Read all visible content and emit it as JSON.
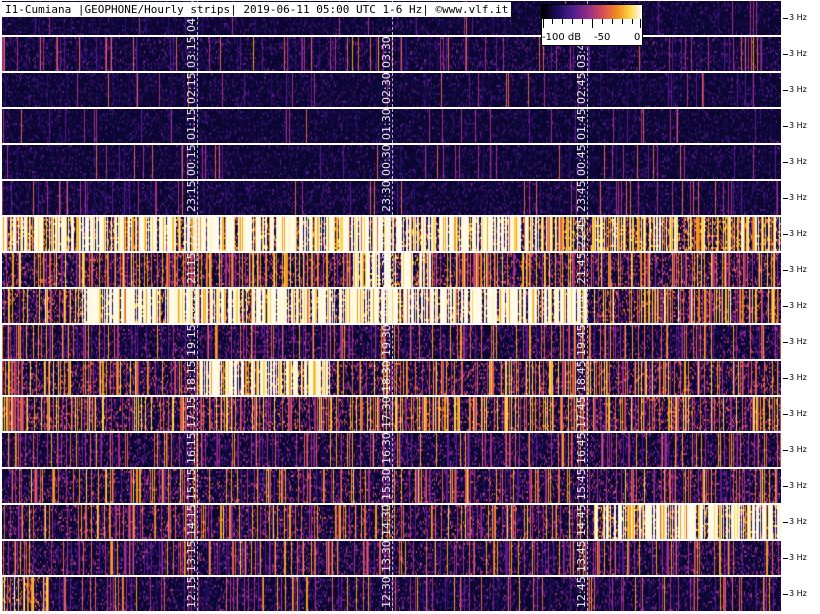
{
  "header": {
    "title": "I1-Cumiana |GEOPHONE/Hourly strips| 2019-06-11 05:00 UTC 1-6 Hz| ©www.vlf.it"
  },
  "colorbar": {
    "labels": [
      "-100 dB",
      "-50",
      "0"
    ]
  },
  "hz_label": "3 Hz",
  "palette": {
    "background": "#0a0630",
    "colors": [
      "#120840",
      "#2a0f6e",
      "#5b1a8c",
      "#a4307e",
      "#e0624a",
      "#f59e1b",
      "#ffd34d",
      "#fff6cc"
    ]
  },
  "strips": [
    {
      "labels": [
        "04:15",
        "",
        ""
      ],
      "intensity": 0.1,
      "hot": []
    },
    {
      "labels": [
        "03:15",
        "03:30",
        "03:45"
      ],
      "intensity": 0.22,
      "hot": []
    },
    {
      "labels": [
        "02:15",
        "02:30",
        "02:45"
      ],
      "intensity": 0.12,
      "hot": []
    },
    {
      "labels": [
        "01:15",
        "01:30",
        "01:45"
      ],
      "intensity": 0.1,
      "hot": []
    },
    {
      "labels": [
        "00:15",
        "00:30",
        "00:45"
      ],
      "intensity": 0.12,
      "hot": []
    },
    {
      "labels": [
        "23:15",
        "23:30",
        "23:45"
      ],
      "intensity": 0.18,
      "hot": []
    },
    {
      "labels": [
        "22:15",
        "22:30",
        "22:45"
      ],
      "intensity": 0.95,
      "hot": [
        0.0,
        0.7
      ]
    },
    {
      "labels": [
        "21:15",
        "21:30",
        "21:45"
      ],
      "intensity": 0.6,
      "hot": [
        0.45,
        0.55
      ]
    },
    {
      "labels": [
        "20:15",
        "20:30",
        "20:45"
      ],
      "intensity": 0.65,
      "hot": [
        0.1,
        0.75
      ]
    },
    {
      "labels": [
        "19:15",
        "19:30",
        "19:45"
      ],
      "intensity": 0.4,
      "hot": []
    },
    {
      "labels": [
        "18:15",
        "18:30",
        "18:45"
      ],
      "intensity": 0.6,
      "hot": [
        0.25,
        0.42
      ]
    },
    {
      "labels": [
        "17:15",
        "17:30",
        "17:45"
      ],
      "intensity": 0.62,
      "hot": []
    },
    {
      "labels": [
        "16:15",
        "16:30",
        "16:45"
      ],
      "intensity": 0.4,
      "hot": []
    },
    {
      "labels": [
        "15:15",
        "15:30",
        "15:45"
      ],
      "intensity": 0.48,
      "hot": []
    },
    {
      "labels": [
        "14:15",
        "14:30",
        "14:45"
      ],
      "intensity": 0.5,
      "hot": [
        0.76,
        1.0
      ]
    },
    {
      "labels": [
        "13:15",
        "13:30",
        "13:45"
      ],
      "intensity": 0.42,
      "hot": []
    },
    {
      "labels": [
        "12:15",
        "12:30",
        "12:45"
      ],
      "intensity": 0.3,
      "hot": [
        0.0,
        0.06
      ]
    }
  ]
}
